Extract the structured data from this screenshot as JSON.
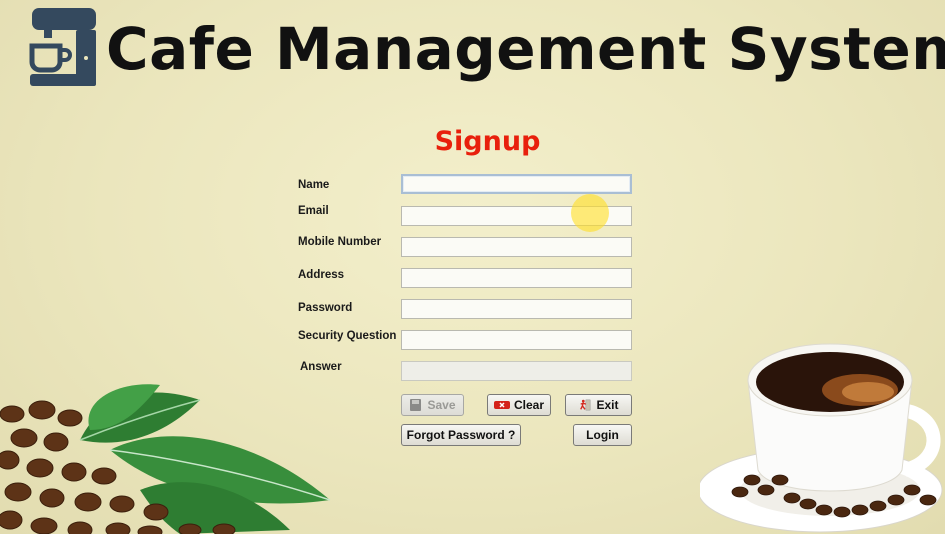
{
  "header": {
    "title": "Cafe Management System",
    "logo_icon": "coffee-machine-icon"
  },
  "page": {
    "title": "Signup"
  },
  "form": {
    "fields": [
      {
        "label": "Name",
        "value": "",
        "state": "focused"
      },
      {
        "label": "Email",
        "value": ""
      },
      {
        "label": "Mobile Number",
        "value": ""
      },
      {
        "label": "Address",
        "value": ""
      },
      {
        "label": "Password",
        "value": ""
      },
      {
        "label": "Security Question",
        "value": ""
      },
      {
        "label": "Answer",
        "value": "",
        "state": "disabled"
      }
    ]
  },
  "buttons": {
    "save": {
      "label": "Save",
      "icon": "save-icon",
      "enabled": false
    },
    "clear": {
      "label": "Clear",
      "icon": "clear-icon"
    },
    "exit": {
      "label": "Exit",
      "icon": "exit-icon"
    },
    "forgot": {
      "label": "Forgot Password ?"
    },
    "login": {
      "label": "Login"
    }
  },
  "colors": {
    "background": "#ebe6bd",
    "title_text": "#111111",
    "signup_title": "#e8200c",
    "logo": "#34495e"
  }
}
